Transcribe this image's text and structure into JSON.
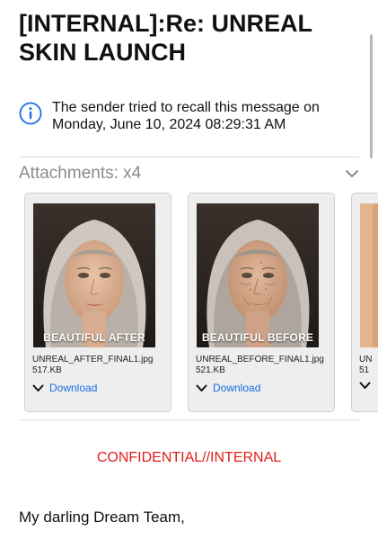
{
  "email": {
    "subject": "[INTERNAL]:Re: UNREAL SKIN LAUNCH",
    "recall_notice": "The sender tried to recall this message on Monday, June 10, 2024 08:29:31 AM"
  },
  "attachments": {
    "label": "Attachments: x4",
    "items": [
      {
        "caption": "BEAUTIFUL AFTER",
        "file_name": "UNREAL_AFTER_FINAL1.jpg",
        "file_size": "517.KB",
        "download_label": "Download"
      },
      {
        "caption": "BEAUTIFUL BEFORE",
        "file_name": "UNREAL_BEFORE_FINAL1.jpg",
        "file_size": "521.KB",
        "download_label": "Download"
      },
      {
        "file_name": "UN",
        "file_size": "51"
      }
    ]
  },
  "body": {
    "classification": "CONFIDENTIAL//INTERNAL",
    "greeting": "My darling Dream Team,"
  },
  "colors": {
    "link": "#1a6ce6",
    "confidential": "#e0201b",
    "muted_label": "#8a8a8a",
    "card_bg": "#eeeeee"
  },
  "icons": {
    "recall": "info-icon",
    "attachments_toggle": "chevron-down-icon",
    "download": "chevron-down-icon"
  }
}
